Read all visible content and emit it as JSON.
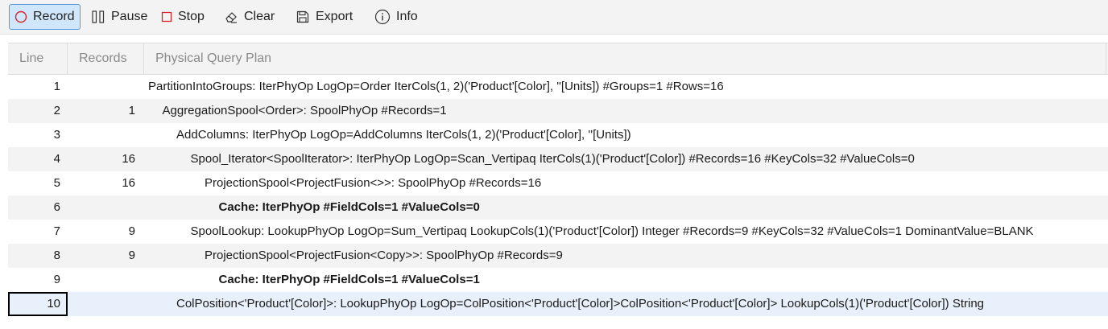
{
  "toolbar": {
    "record": "Record",
    "pause": "Pause",
    "stop": "Stop",
    "clear": "Clear",
    "export": "Export",
    "info": "Info"
  },
  "columns": {
    "line": "Line",
    "records": "Records",
    "plan": "Physical Query Plan"
  },
  "rows": [
    {
      "line": "1",
      "records": "",
      "indent": 0,
      "bold": false,
      "plan": "PartitionIntoGroups: IterPhyOp LogOp=Order IterCols(1, 2)('Product'[Color], ''[Units]) #Groups=1 #Rows=16"
    },
    {
      "line": "2",
      "records": "1",
      "indent": 1,
      "bold": false,
      "plan": "AggregationSpool<Order>: SpoolPhyOp #Records=1"
    },
    {
      "line": "3",
      "records": "",
      "indent": 2,
      "bold": false,
      "plan": "AddColumns: IterPhyOp LogOp=AddColumns IterCols(1, 2)('Product'[Color], ''[Units])"
    },
    {
      "line": "4",
      "records": "16",
      "indent": 3,
      "bold": false,
      "plan": "Spool_Iterator<SpoolIterator>: IterPhyOp LogOp=Scan_Vertipaq IterCols(1)('Product'[Color]) #Records=16 #KeyCols=32 #ValueCols=0"
    },
    {
      "line": "5",
      "records": "16",
      "indent": 4,
      "bold": false,
      "plan": "ProjectionSpool<ProjectFusion<>>: SpoolPhyOp #Records=16"
    },
    {
      "line": "6",
      "records": "",
      "indent": 5,
      "bold": true,
      "plan": "Cache: IterPhyOp #FieldCols=1 #ValueCols=0"
    },
    {
      "line": "7",
      "records": "9",
      "indent": 3,
      "bold": false,
      "plan": "SpoolLookup: LookupPhyOp LogOp=Sum_Vertipaq LookupCols(1)('Product'[Color]) Integer #Records=9 #KeyCols=32 #ValueCols=1 DominantValue=BLANK"
    },
    {
      "line": "8",
      "records": "9",
      "indent": 4,
      "bold": false,
      "plan": "ProjectionSpool<ProjectFusion<Copy>>: SpoolPhyOp #Records=9"
    },
    {
      "line": "9",
      "records": "",
      "indent": 5,
      "bold": true,
      "plan": "Cache: IterPhyOp #FieldCols=1 #ValueCols=1"
    },
    {
      "line": "10",
      "records": "",
      "indent": 2,
      "bold": false,
      "plan": "ColPosition<'Product'[Color]>: LookupPhyOp LogOp=ColPosition<'Product'[Color]>ColPosition<'Product'[Color]> LookupCols(1)('Product'[Color]) String"
    }
  ],
  "selected_line": "10",
  "icons": {
    "record": "record-circle-icon",
    "pause": "pause-icon",
    "stop": "stop-square-icon",
    "clear": "eraser-icon",
    "export": "save-disk-icon",
    "info": "info-circle-icon"
  },
  "colors": {
    "record_accent": "#d9262b",
    "selection_bg": "#cfe6fb"
  }
}
